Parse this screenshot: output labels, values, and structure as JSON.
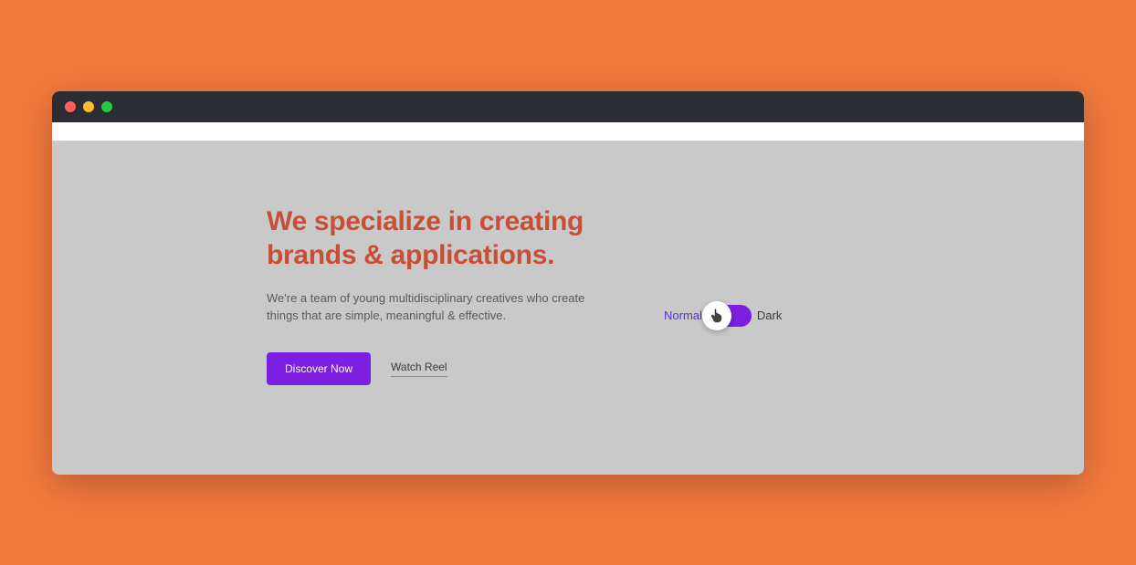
{
  "hero": {
    "title": "We specialize in creating brands & applications.",
    "subtitle": "We're a team of young multidisciplinary creatives who create things that are simple, meaningful & effective."
  },
  "cta": {
    "primary": "Discover Now",
    "secondary": "Watch Reel"
  },
  "toggle": {
    "left": "Normal",
    "right": "Dark"
  },
  "colors": {
    "brandOrange": "#f37a3e",
    "headline": "#c84f36",
    "accent": "#7c1fe0"
  }
}
